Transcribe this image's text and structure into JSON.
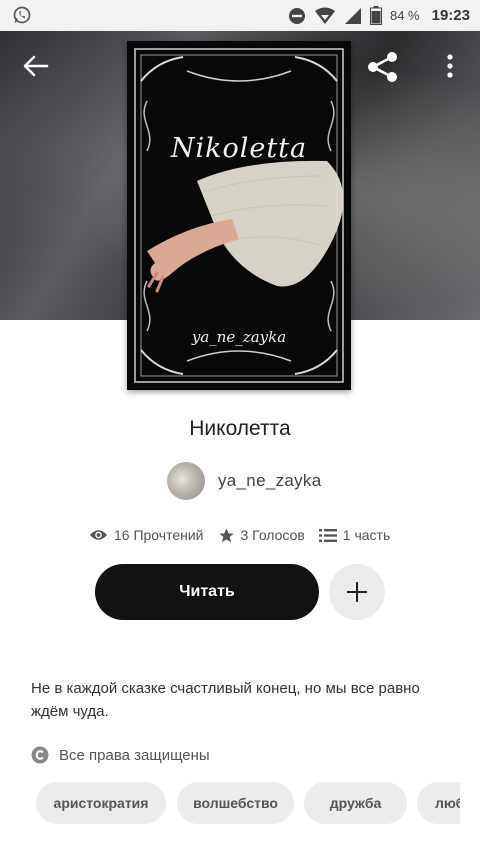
{
  "status_bar": {
    "battery_percent": "84 %",
    "time": "19:23"
  },
  "cover": {
    "title": "Nikoletta",
    "author": "ya_ne_zayka"
  },
  "book": {
    "title": "Николетта",
    "author": "ya_ne_zayka",
    "stats": {
      "reads": "16 Прочтений",
      "votes": "3 Голосов",
      "parts": "1 часть"
    },
    "read_label": "Читать",
    "description": "Не в каждой сказке счастливый конец, но мы все равно ждём чуда.",
    "rights": "Все права защищены",
    "tags": [
      "аристократия",
      "волшебство",
      "дружба",
      "люб"
    ]
  },
  "icons": {
    "back": "arrow-left-icon",
    "share": "share-icon",
    "more": "more-vertical-icon",
    "add": "plus-icon",
    "reads": "eye-icon",
    "votes": "star-icon",
    "parts": "list-icon",
    "rights": "copyright-icon"
  },
  "colors": {
    "read_button_bg": "#121212",
    "chip_bg": "#ececec"
  }
}
